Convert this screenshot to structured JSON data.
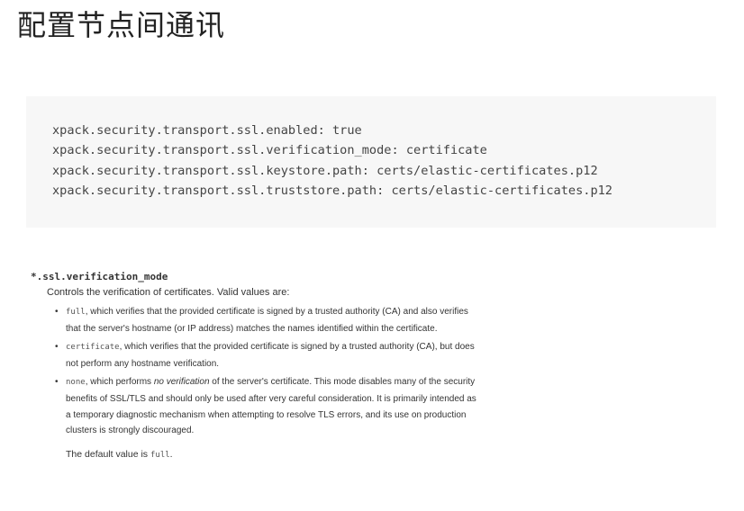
{
  "page": {
    "title": "配置节点间通讯"
  },
  "code_block": {
    "lines": [
      "xpack.security.transport.ssl.enabled: true",
      "xpack.security.transport.ssl.verification_mode: certificate",
      "xpack.security.transport.ssl.keystore.path: certs/elastic-certificates.p12",
      "xpack.security.transport.ssl.truststore.path: certs/elastic-certificates.p12"
    ]
  },
  "setting": {
    "name": "*.ssl.verification_mode",
    "description": "Controls the verification of certificates. Valid values are:",
    "bullet_glyph": "•",
    "values": [
      {
        "code": "full",
        "text": ", which verifies that the provided certificate is signed by a trusted authority (CA) and also verifies that the server's hostname (or IP address) matches the names identified within the certificate."
      },
      {
        "code": "certificate",
        "text": ", which verifies that the provided certificate is signed by a trusted authority (CA), but does not perform any hostname verification."
      },
      {
        "code": "none",
        "text_before": ", which performs ",
        "emphasis": "no verification",
        "text_after": " of the server's certificate. This mode disables many of the security benefits of SSL/TLS and should only be used after very careful consideration. It is primarily intended as a temporary diagnostic mechanism when attempting to resolve TLS errors, and its use on production clusters is strongly discouraged."
      }
    ],
    "default_prefix": "The default value is ",
    "default_value": "full",
    "default_suffix": "."
  }
}
